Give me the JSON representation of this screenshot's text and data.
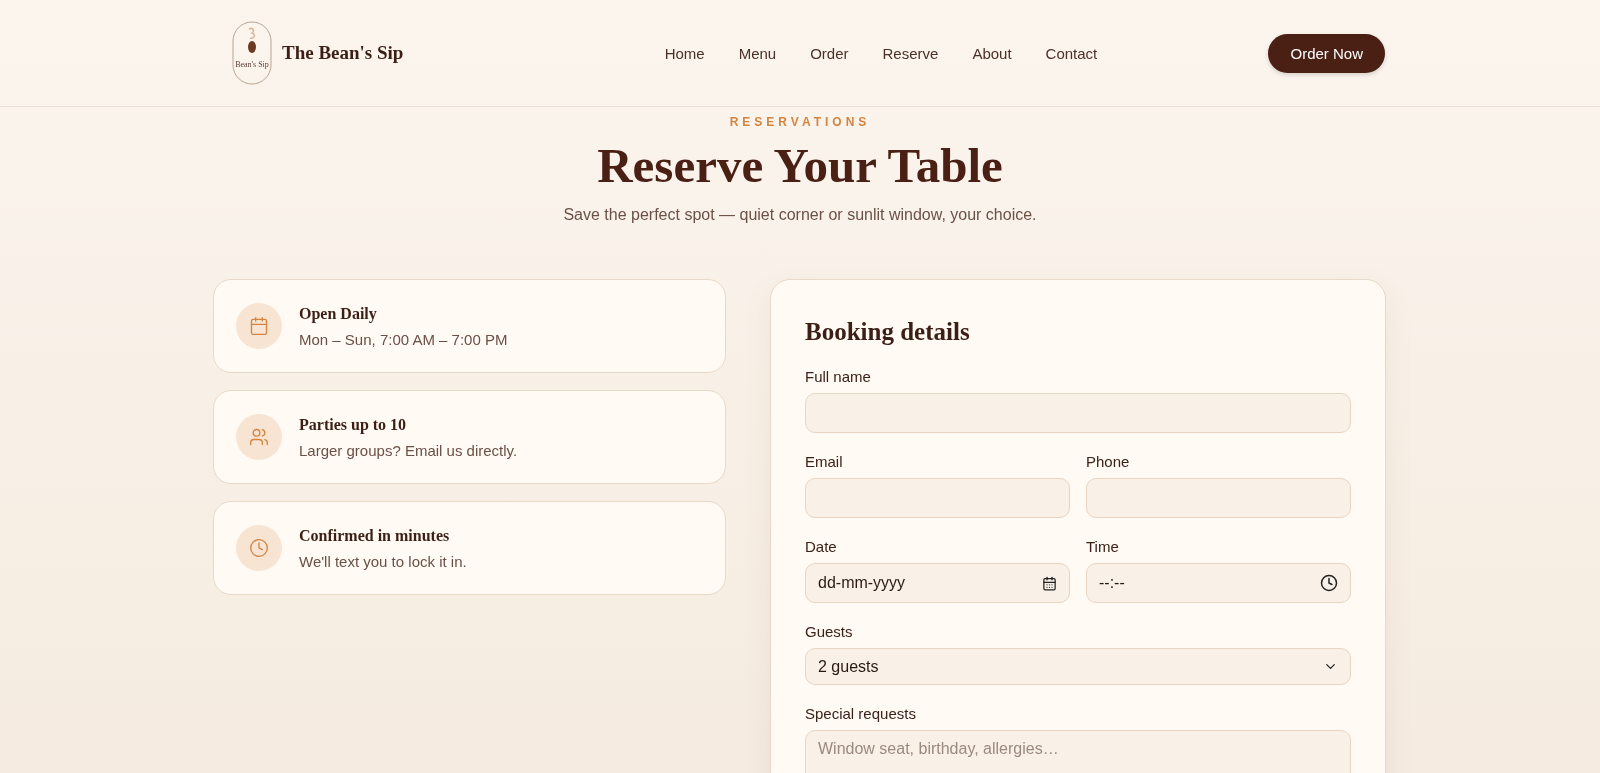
{
  "brand": {
    "name": "The Bean's Sip",
    "logo": {
      "name": "Bean's Sip"
    }
  },
  "nav": [
    {
      "label": "Home",
      "selected": false
    },
    {
      "label": "Menu",
      "selected": false
    },
    {
      "label": "Order",
      "selected": false
    },
    {
      "label": "Reserve",
      "selected": false
    },
    {
      "label": "About",
      "selected": false
    },
    {
      "label": "Contact",
      "selected": false
    }
  ],
  "cta": "Order Now",
  "hero": {
    "eyebrow": "RESERVATIONS",
    "title": "Reserve Your Table",
    "subtitle": "Save the perfect spot — quiet corner or sunlit window, your choice."
  },
  "info_cards": [
    {
      "kind": "calendar",
      "title": "Open Daily",
      "text": "Mon – Sun, 7:00 AM – 7:00 PM"
    },
    {
      "kind": "people",
      "title": "Parties up to 10",
      "text": "Larger groups? Email us directly."
    },
    {
      "kind": "clock",
      "title": "Confirmed in minutes",
      "text": "We'll text you to lock it in."
    }
  ],
  "form": {
    "title": "Booking details",
    "rows": [
      [
        {
          "kind": "text",
          "label": "Full name"
        }
      ],
      [
        {
          "kind": "text",
          "label": "Email"
        },
        {
          "kind": "text",
          "label": "Phone"
        }
      ],
      [
        {
          "kind": "date",
          "label": "Date",
          "placeholder": "dd-mm-yyyy"
        },
        {
          "kind": "time",
          "label": "Time",
          "placeholder": "--:--"
        }
      ],
      [
        {
          "kind": "select",
          "label": "Guests",
          "value": "2 guests"
        }
      ],
      [
        {
          "kind": "textarea",
          "label": "Special requests",
          "placeholder": "Window seat, birthday, allergies…"
        }
      ]
    ]
  }
}
